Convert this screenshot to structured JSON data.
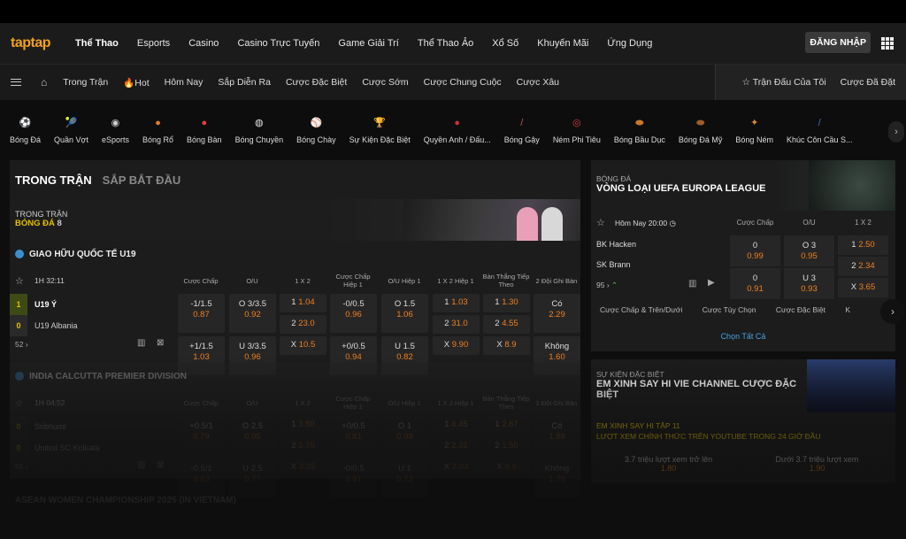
{
  "nav": {
    "logo": "taptap",
    "items": [
      "Thể Thao",
      "Esports",
      "Casino",
      "Casino Trực Tuyến",
      "Game Giải Trí",
      "Thể Thao Ảo",
      "Xổ Số",
      "Khuyến Mãi",
      "Ứng Dụng"
    ],
    "login": "ĐĂNG NHẬP"
  },
  "subnav": {
    "items": [
      "Trong Trận",
      "Hot",
      "Hôm Nay",
      "Sắp Diễn Ra",
      "Cược Đặc Biệt",
      "Cược Sớm",
      "Cược Chung Cuộc",
      "Cược Xâu"
    ],
    "right": [
      "Trận Đấu Của Tôi",
      "Cược Đã Đặt"
    ]
  },
  "sports": [
    {
      "label": "Bóng Đá",
      "icon": "soccer-ball-icon",
      "color": "#ffffff"
    },
    {
      "label": "Quần Vợt",
      "icon": "tennis-icon",
      "color": "#e8d36a"
    },
    {
      "label": "eSports",
      "icon": "esports-icon",
      "color": "#cfcfcf"
    },
    {
      "label": "Bóng Rổ",
      "icon": "basketball-icon",
      "color": "#e57b2c"
    },
    {
      "label": "Bóng Bàn",
      "icon": "table-tennis-icon",
      "color": "#e04040"
    },
    {
      "label": "Bóng Chuyền",
      "icon": "volleyball-icon",
      "color": "#e0e0e0"
    },
    {
      "label": "Bóng Chày",
      "icon": "baseball-icon",
      "color": "#f0f0f0"
    },
    {
      "label": "Sự Kiện Đặc Biệt",
      "icon": "trophy-icon",
      "color": "#e7b52a"
    },
    {
      "label": "Quyền Anh / Đấu...",
      "icon": "boxing-glove-icon",
      "color": "#c83030"
    },
    {
      "label": "Bóng Gậy",
      "icon": "cricket-icon",
      "color": "#c85050"
    },
    {
      "label": "Ném Phi Tiêu",
      "icon": "darts-icon",
      "color": "#d83c3c"
    },
    {
      "label": "Bóng Bầu Dục",
      "icon": "rugby-icon",
      "color": "#c8782c"
    },
    {
      "label": "Bóng Đá Mỹ",
      "icon": "american-football-icon",
      "color": "#a05a2c"
    },
    {
      "label": "Bóng Ném",
      "icon": "handball-icon",
      "color": "#e08a2c"
    },
    {
      "label": "Khúc Côn Cầu S...",
      "icon": "hockey-icon",
      "color": "#3a6fd0"
    }
  ],
  "main": {
    "tab_live": "TRONG TRẬN",
    "tab_upcoming": "SẮP BẮT ĐẦU",
    "banner_line1": "TRONG TRẬN",
    "banner_sport": "BÓNG ĐÁ",
    "banner_count": "8"
  },
  "columns": [
    "Cược Chấp",
    "O/U",
    "1 X 2",
    "Cược Chấp Hiệp 1",
    "O/U Hiệp 1",
    "1 X 2 Hiệp 1",
    "Bàn Thắng Tiếp Theo",
    "2 Đội Ghi Bàn"
  ],
  "leagues": [
    {
      "name": "GIAO HỮU QUỐC TẾ U19",
      "time": "1H 32:11",
      "more": "52",
      "teams": [
        {
          "name": "U19 Ý",
          "score": "1"
        },
        {
          "name": "U19 Albania",
          "score": "0"
        }
      ],
      "odds": [
        [
          [
            "-1/1.5",
            "0.87"
          ],
          [
            "+1/1.5",
            "1.03"
          ]
        ],
        [
          [
            "O 3/3.5",
            "0.92"
          ],
          [
            "U 3/3.5",
            "0.96"
          ]
        ],
        [
          [
            "1",
            "1.04"
          ],
          [
            "2",
            "23.0"
          ],
          [
            "X",
            "10.5"
          ]
        ],
        [
          [
            "-0/0.5",
            "0.96"
          ],
          [
            "+0/0.5",
            "0.94"
          ]
        ],
        [
          [
            "O 1.5",
            "1.06"
          ],
          [
            "U 1.5",
            "0.82"
          ]
        ],
        [
          [
            "1",
            "1.03"
          ],
          [
            "2",
            "31.0"
          ],
          [
            "X",
            "9.90"
          ]
        ],
        [
          [
            "1",
            "1.30"
          ],
          [
            "2",
            "4.55"
          ],
          [
            "X",
            "8.9"
          ]
        ],
        [
          [
            "Có",
            "2.29"
          ],
          [
            "Không",
            "1.60"
          ]
        ]
      ]
    },
    {
      "name": "INDIA CALCUTTA PREMIER DIVISION",
      "time": "1H 04:52",
      "more": "55",
      "teams": [
        {
          "name": "Sribhumi",
          "score": "0"
        },
        {
          "name": "United SC Kolkata",
          "score": "0"
        }
      ],
      "odds": [
        [
          [
            "+0.5/1",
            "0.79"
          ],
          [
            "-0.5/1",
            "0.93"
          ]
        ],
        [
          [
            "O 2.5",
            "0.95"
          ],
          [
            "U 2.5",
            "0.77"
          ]
        ],
        [
          [
            "1",
            "3.80"
          ],
          [
            "2",
            "1.70"
          ],
          [
            "X",
            "3.35"
          ]
        ],
        [
          [
            "+0/0.5",
            "0.81"
          ],
          [
            "-0/0.5",
            "0.91"
          ]
        ],
        [
          [
            "O 1",
            "0.99"
          ],
          [
            "U 1",
            "0.73"
          ]
        ],
        [
          [
            "1",
            "4.45"
          ],
          [
            "2",
            "2.31"
          ],
          [
            "X",
            "2.03"
          ]
        ],
        [
          [
            "1",
            "2.67"
          ],
          [
            "2",
            "1.55"
          ],
          [
            "X",
            "9.9"
          ]
        ],
        [
          [
            "Có",
            "1.88"
          ],
          [
            "Không",
            "1.79"
          ]
        ]
      ]
    }
  ],
  "faded_league": "ASEAN WOMEN CHAMPIONSHIP 2025 (IN VIETNAM)",
  "feature": {
    "sport": "BÓNG ĐÁ",
    "title": "VÒNG LOẠI UEFA EUROPA LEAGUE",
    "time": "Hôm Nay 20:00",
    "cols": [
      "Cược Chấp",
      "O/U",
      "1 X 2"
    ],
    "teams": [
      "BK Hacken",
      "SK Brann"
    ],
    "more": "95",
    "hdp": [
      [
        "0",
        "0.99"
      ],
      [
        "0",
        "0.91"
      ]
    ],
    "ou": [
      [
        "O 3",
        "0.95"
      ],
      [
        "U 3",
        "0.93"
      ]
    ],
    "x12": [
      [
        "1",
        "2.50"
      ],
      [
        "2",
        "2.34"
      ],
      [
        "X",
        "3.65"
      ]
    ],
    "pills": [
      "Cược Chấp & Trên/Dưới",
      "Cược Tùy Chọn",
      "Cược Đặc Biệt",
      "K"
    ],
    "select_all": "Chọn Tất Cả"
  },
  "special": {
    "label": "SỰ KIỆN ĐẶC BIỆT",
    "title": "EM XINH SAY HI VIE CHANNEL CƯỢC ĐẶC BIỆT",
    "sub1": "EM XINH SAY HI TẬP 11",
    "sub2": "LƯỢT XEM CHÍNH THỨC TRÊN YOUTUBE TRONG 24 GIỜ ĐẦU",
    "opt1": "3.7 triệu lượt xem trở lên",
    "opt1_odds": "1.80",
    "opt2": "Dưới 3.7 triệu lượt xem",
    "opt2_odds": "1.90"
  }
}
